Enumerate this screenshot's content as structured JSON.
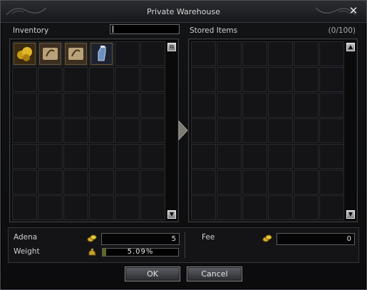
{
  "window": {
    "title": "Private Warehouse",
    "close_glyph": "✕"
  },
  "inventory": {
    "label": "Inventory",
    "search_value": "",
    "items": [
      {
        "name": "gold-ore-icon",
        "color": "#c79a14"
      },
      {
        "name": "scroll-icon",
        "color": "#b8a27a"
      },
      {
        "name": "scroll-icon",
        "color": "#b8a27a"
      },
      {
        "name": "potion-bottle-icon",
        "color": "#6a8fc0"
      }
    ],
    "scroll_up_glyph": "⧉",
    "scroll_down_glyph": "▼"
  },
  "stored": {
    "label": "Stored Items",
    "count": "(0/100)",
    "scroll_up_glyph": "▲",
    "scroll_down_glyph": "▼"
  },
  "transfer_arrow": "arrow-right-icon",
  "footer": {
    "adena_label": "Adena",
    "adena_value": "5",
    "weight_label": "Weight",
    "weight_text": "5.09%",
    "weight_fraction": 0.0509,
    "fee_label": "Fee",
    "fee_value": "0"
  },
  "buttons": {
    "ok": "OK",
    "cancel": "Cancel"
  }
}
